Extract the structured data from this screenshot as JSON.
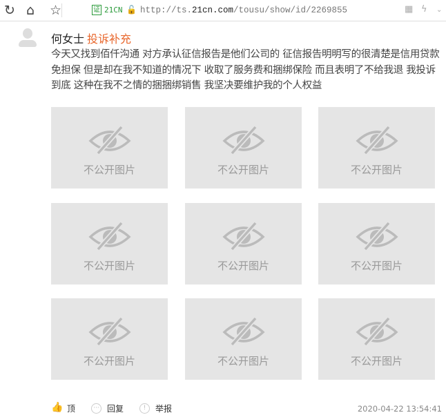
{
  "browser": {
    "site_label": "21CN",
    "cert_label": "证",
    "url_plain_prefix": "http://ts.",
    "url_domain": "21cn.com",
    "url_path": "/tousu/show/id/2269855"
  },
  "post": {
    "author": "何女士",
    "tag": "投诉补充",
    "content": "今天又找到佰仟沟通 对方承认征信报告是他们公司的 征信报告明明写的很清楚是信用贷款免担保 但是却在我不知道的情况下 收取了服务费和捆绑保险 而且表明了不给我退 我投诉到底 这种在我不之情的捆捆绑销售 我坚决要维护我的个人权益",
    "images": [
      "不公开图片",
      "不公开图片",
      "不公开图片",
      "不公开图片",
      "不公开图片",
      "不公开图片",
      "不公开图片",
      "不公开图片",
      "不公开图片"
    ],
    "actions": {
      "like": "顶",
      "reply": "回复",
      "report": "举报"
    },
    "timestamp": "2020-04-22 13:54:41"
  },
  "colors": {
    "accent": "#e8662b",
    "cert": "#2a9a3a"
  }
}
